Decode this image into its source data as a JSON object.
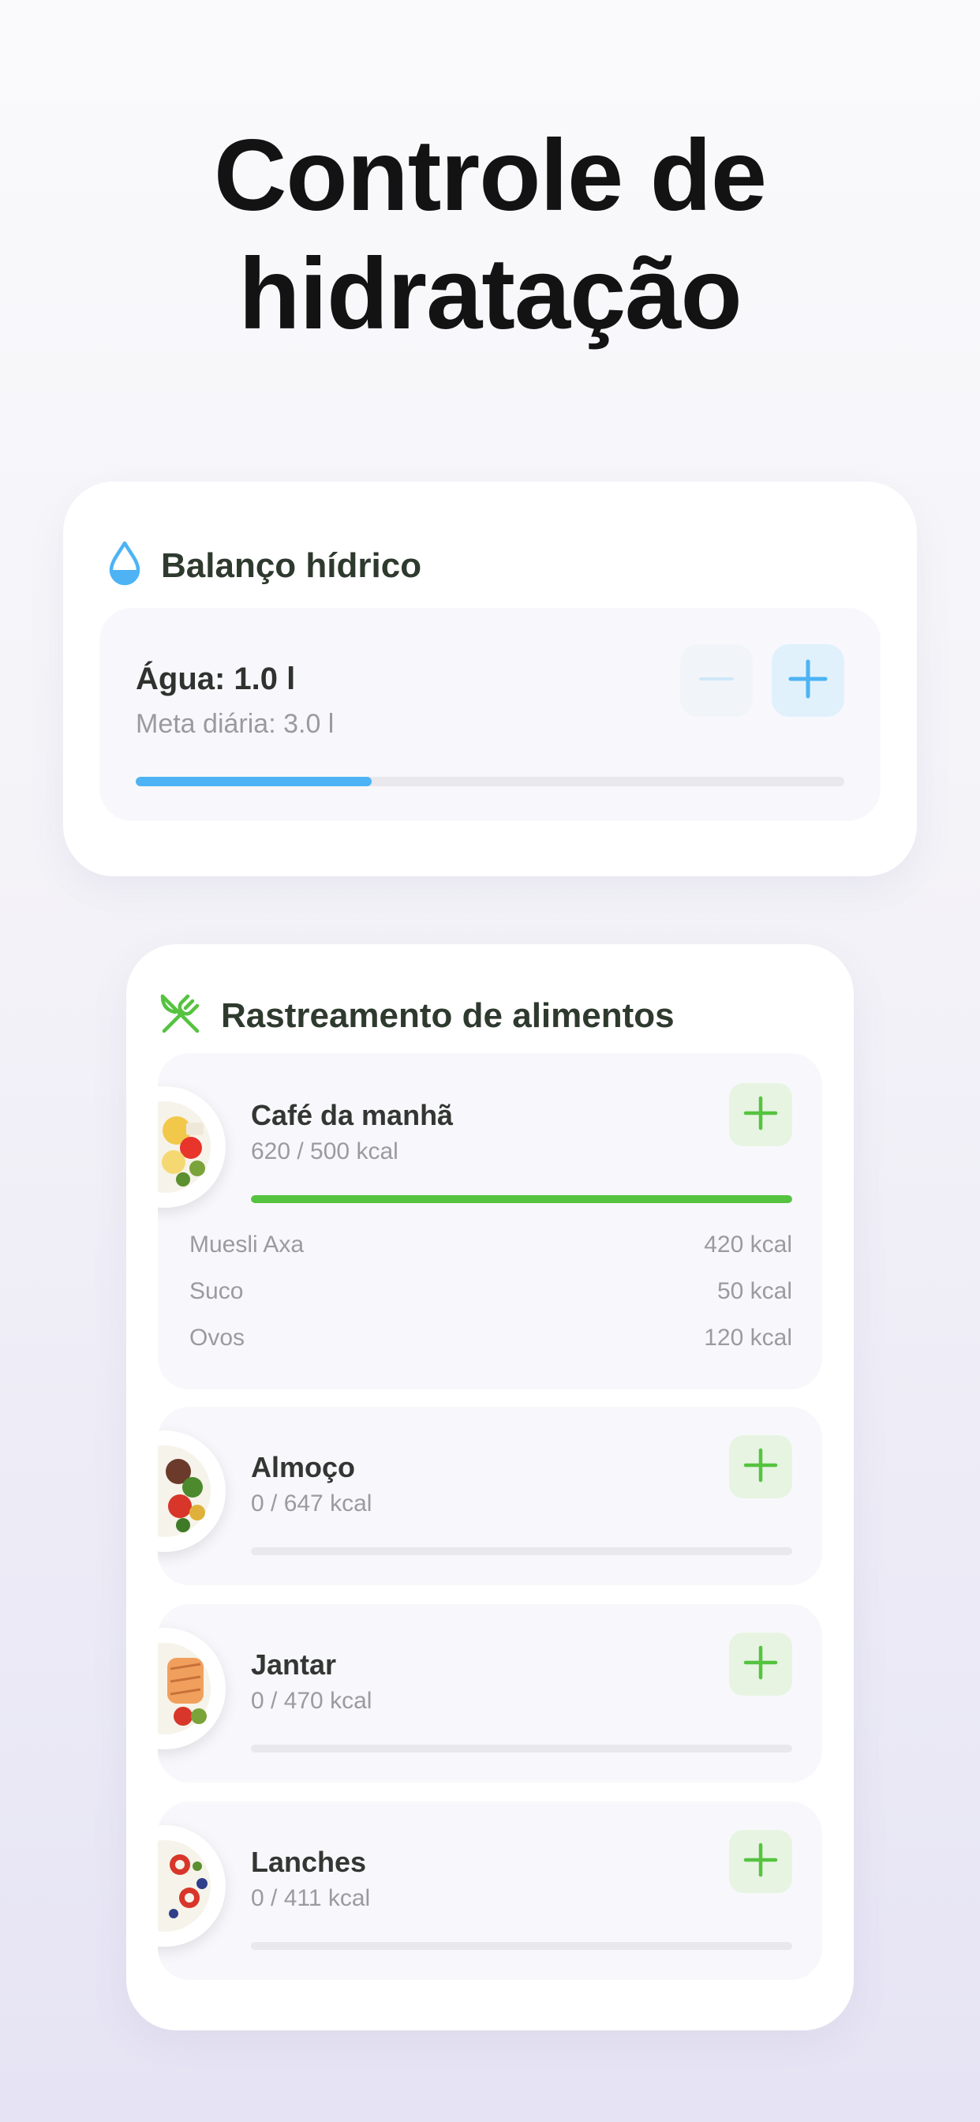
{
  "headline": {
    "line1": "Controle de",
    "line2": "hidratação"
  },
  "water": {
    "title": "Balanço hídrico",
    "amount_label": "Água: 1.0 l",
    "goal_label": "Meta diária: 3.0 l",
    "progress": 0.333,
    "accent": "#4db3f4",
    "icons": {
      "title": "water-drop-icon",
      "decrease": "minus-icon",
      "increase": "plus-icon"
    }
  },
  "food": {
    "title": "Rastreamento de alimentos",
    "accent": "#55c33f",
    "icons": {
      "title": "fork-knife-icon",
      "add": "plus-icon"
    },
    "meals": [
      {
        "name": "Café da manhã",
        "kcal": "620 / 500 kcal",
        "progress": 1.0,
        "items": [
          {
            "name": "Muesli Axa",
            "kcal": "420 kcal"
          },
          {
            "name": "Suco",
            "kcal": "50 kcal"
          },
          {
            "name": "Ovos",
            "kcal": "120 kcal"
          }
        ]
      },
      {
        "name": "Almoço",
        "kcal": "0 / 647 kcal",
        "progress": 0
      },
      {
        "name": "Jantar",
        "kcal": "0 / 470 kcal",
        "progress": 0
      },
      {
        "name": "Lanches",
        "kcal": "0 / 411 kcal",
        "progress": 0
      }
    ]
  }
}
